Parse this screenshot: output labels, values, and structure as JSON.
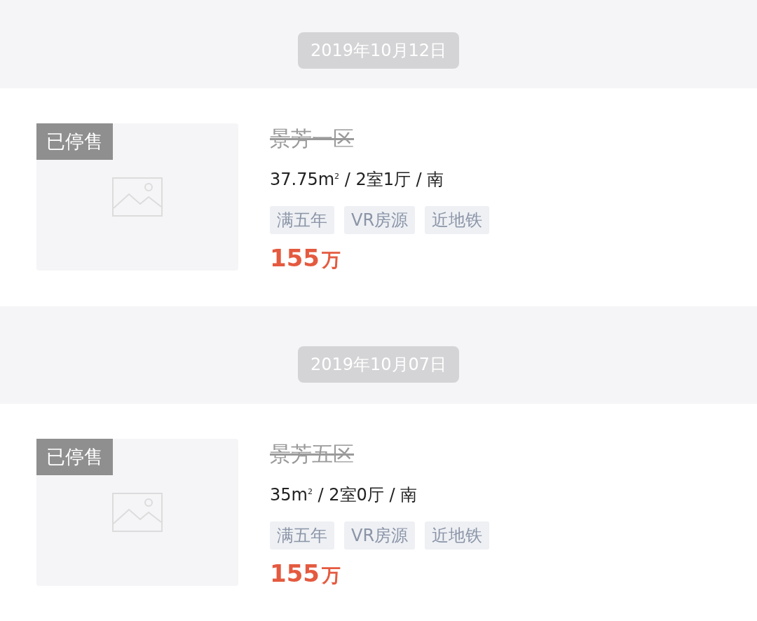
{
  "groups": [
    {
      "date": "2019年10月12日",
      "listings": [
        {
          "badge": "已停售",
          "title": "景芳一区",
          "strikethrough": true,
          "info": "37.75m$^{2}$ / 2室1厅 / 南",
          "tags": [
            "满五年",
            "VR房源",
            "近地铁"
          ],
          "price": "155",
          "price_unit": "万"
        }
      ]
    },
    {
      "date": "2019年10月07日",
      "listings": [
        {
          "badge": "已停售",
          "title": "景芳五区",
          "strikethrough": true,
          "info": "35m$^{2}$ / 2室0厅 / 南",
          "tags": [
            "满五年",
            "VR房源",
            "近地铁"
          ],
          "price": "155",
          "price_unit": "万"
        }
      ]
    }
  ]
}
